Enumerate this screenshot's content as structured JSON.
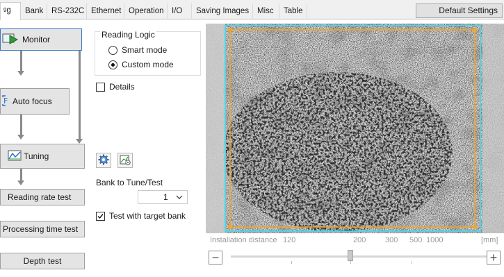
{
  "tabs": [
    {
      "label": "ᵍg",
      "active": true
    },
    {
      "label": "Bank"
    },
    {
      "label": "RS-232C"
    },
    {
      "label": "Ethernet"
    },
    {
      "label": "Operation"
    },
    {
      "label": "I/O"
    },
    {
      "label": "Saving Images"
    },
    {
      "label": "Misc"
    },
    {
      "label": "Table"
    }
  ],
  "default_settings_label": "Default Settings",
  "flow": {
    "monitor": "Monitor",
    "auto_focus": "Auto focus",
    "tuning": "Tuning",
    "reading_rate_test": "Reading rate test",
    "processing_time_test": "Processing time test",
    "depth_test": "Depth test"
  },
  "reading_logic": {
    "title": "Reading Logic",
    "options": [
      {
        "label": "Smart mode",
        "selected": false
      },
      {
        "label": "Custom mode",
        "selected": true
      }
    ]
  },
  "details": {
    "label": "Details",
    "checked": false
  },
  "bank_to_tune": {
    "label": "Bank to Tune/Test",
    "value": "1"
  },
  "test_with_target_bank": {
    "label": "Test with target bank",
    "checked": true
  },
  "scale": {
    "label": "Installation distance",
    "ticks": [
      "120",
      "200",
      "300",
      "500",
      "1000"
    ],
    "unit": "[mm]",
    "minus": "−",
    "plus": "+"
  },
  "colors": {
    "accent": "#3a79c6",
    "roi": "#f5a623",
    "frame": "#4fd3e6"
  },
  "icons": [
    "monitor-icon",
    "auto-focus-icon",
    "tuning-icon",
    "gear-icon",
    "chart-settings-icon"
  ]
}
